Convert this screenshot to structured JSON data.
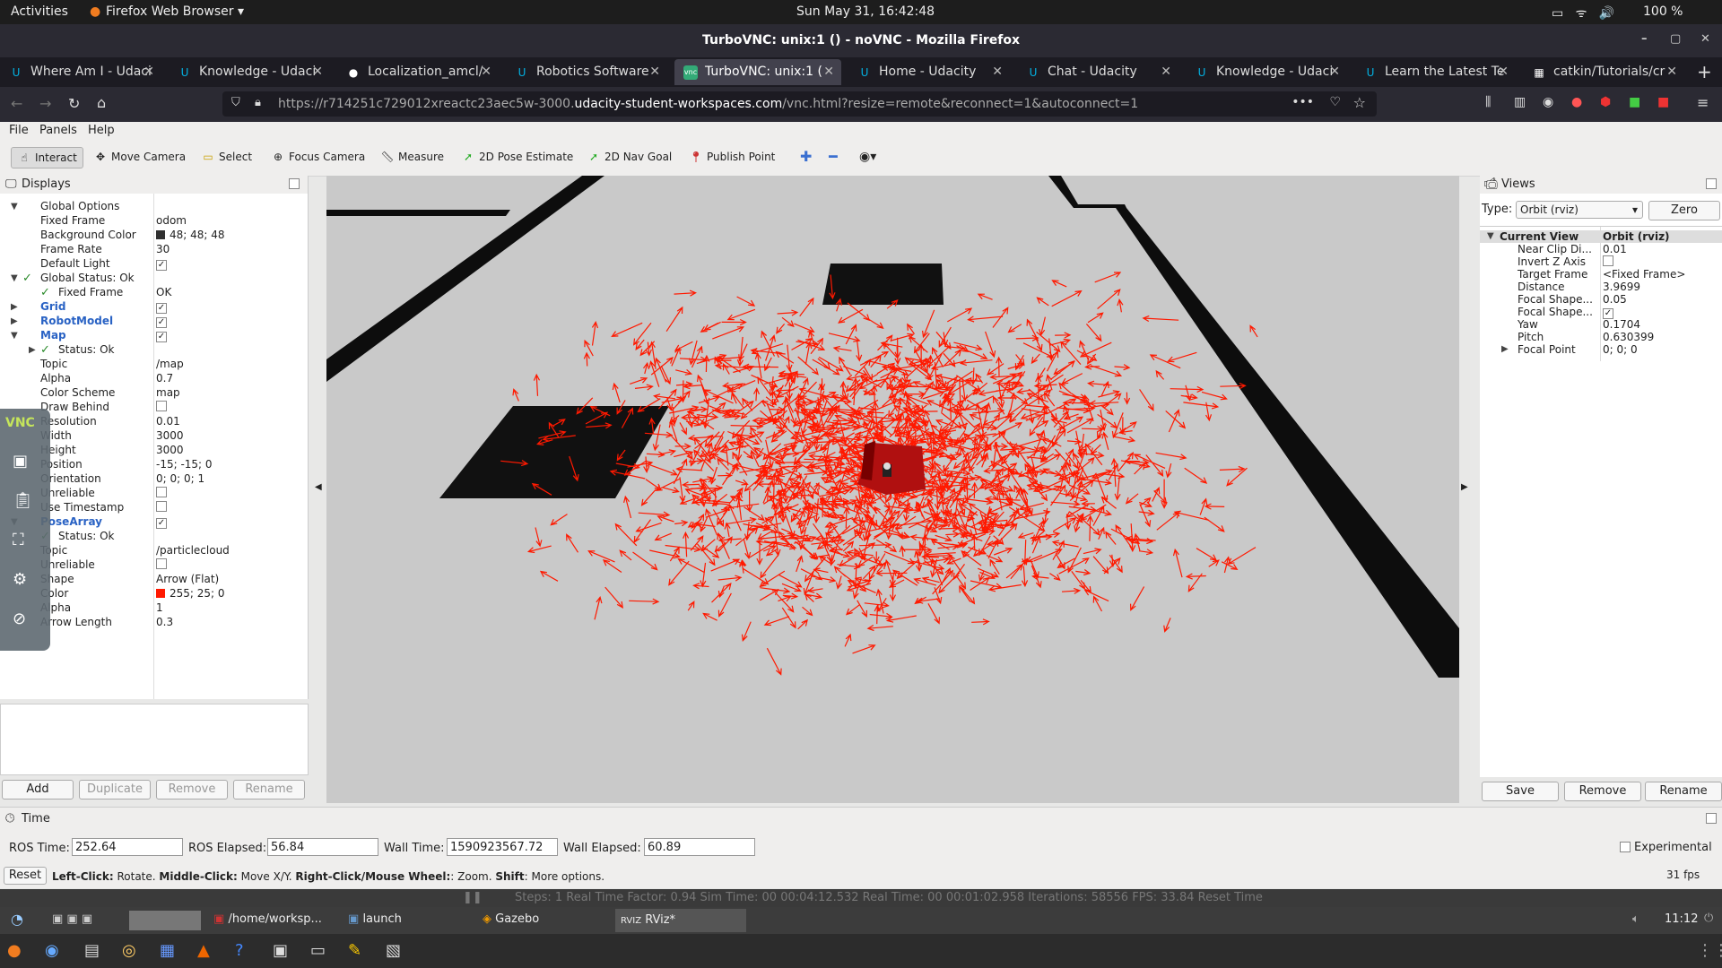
{
  "gnome": {
    "activities": "Activities",
    "app": "Firefox Web Browser ▾",
    "clock": "Sun May 31, 16:42:48",
    "battery": "100 %"
  },
  "window": {
    "title": "TurboVNC: unix:1 () - noVNC - Mozilla Firefox"
  },
  "tabs": [
    {
      "label": "Where Am I - Udaci"
    },
    {
      "label": "Knowledge - Udaci"
    },
    {
      "label": "Localization_amcl/"
    },
    {
      "label": "Robotics Software"
    },
    {
      "label": "TurboVNC: unix:1 ("
    },
    {
      "label": "Home - Udacity"
    },
    {
      "label": "Chat - Udacity"
    },
    {
      "label": "Knowledge - Udaci"
    },
    {
      "label": "Learn the Latest Te"
    },
    {
      "label": "catkin/Tutorials/cr"
    }
  ],
  "url": {
    "prefix": "https://r714251c729012xreactc23aec5w-3000.",
    "domain": "udacity-student-workspaces.com",
    "suffix": "/vnc.html?resize=remote&reconnect=1&autoconnect=1"
  },
  "menu": {
    "file": "File",
    "panels": "Panels",
    "help": "Help"
  },
  "tools": [
    "Interact",
    "Move Camera",
    "Select",
    "Focus Camera",
    "Measure",
    "2D Pose Estimate",
    "2D Nav Goal",
    "Publish Point"
  ],
  "displays": {
    "title": "Displays",
    "rows": [
      {
        "k": "Global Options",
        "v": ""
      },
      {
        "k": "Fixed Frame",
        "v": "odom"
      },
      {
        "k": "Background Color",
        "v": "48; 48; 48"
      },
      {
        "k": "Frame Rate",
        "v": "30"
      },
      {
        "k": "Default Light",
        "v": ""
      },
      {
        "k": "Global Status: Ok",
        "v": ""
      },
      {
        "k": "Fixed Frame",
        "v": "OK"
      },
      {
        "k": "Grid",
        "v": ""
      },
      {
        "k": "RobotModel",
        "v": ""
      },
      {
        "k": "Map",
        "v": ""
      },
      {
        "k": "Status: Ok",
        "v": ""
      },
      {
        "k": "Topic",
        "v": "/map"
      },
      {
        "k": "Alpha",
        "v": "0.7"
      },
      {
        "k": "Color Scheme",
        "v": "map"
      },
      {
        "k": "Draw Behind",
        "v": ""
      },
      {
        "k": "Resolution",
        "v": "0.01"
      },
      {
        "k": "Width",
        "v": "3000"
      },
      {
        "k": "Height",
        "v": "3000"
      },
      {
        "k": "Position",
        "v": "-15; -15; 0"
      },
      {
        "k": "Orientation",
        "v": "0; 0; 0; 1"
      },
      {
        "k": "Unreliable",
        "v": ""
      },
      {
        "k": "Use Timestamp",
        "v": ""
      },
      {
        "k": "PoseArray",
        "v": ""
      },
      {
        "k": "Status: Ok",
        "v": ""
      },
      {
        "k": "Topic",
        "v": "/particlecloud"
      },
      {
        "k": "Unreliable",
        "v": ""
      },
      {
        "k": "Shape",
        "v": "Arrow (Flat)"
      },
      {
        "k": "Color",
        "v": "255; 25; 0"
      },
      {
        "k": "Alpha",
        "v": "1"
      },
      {
        "k": "Arrow Length",
        "v": "0.3"
      }
    ],
    "buttons": {
      "add": "Add",
      "duplicate": "Duplicate",
      "remove": "Remove",
      "rename": "Rename"
    }
  },
  "views": {
    "title": "Views",
    "type_label": "Type:",
    "type_value": "Orbit (rviz)",
    "zero": "Zero",
    "rows": [
      {
        "k": "Current View",
        "v": "Orbit (rviz)"
      },
      {
        "k": "Near Clip Di...",
        "v": "0.01"
      },
      {
        "k": "Invert Z Axis",
        "v": ""
      },
      {
        "k": "Target Frame",
        "v": "<Fixed Frame>"
      },
      {
        "k": "Distance",
        "v": "3.9699"
      },
      {
        "k": "Focal Shape...",
        "v": "0.05"
      },
      {
        "k": "Focal Shape...",
        "v": ""
      },
      {
        "k": "Yaw",
        "v": "0.1704"
      },
      {
        "k": "Pitch",
        "v": "0.630399"
      },
      {
        "k": "Focal Point",
        "v": "0; 0; 0"
      }
    ],
    "buttons": {
      "save": "Save",
      "remove": "Remove",
      "rename": "Rename"
    }
  },
  "time": {
    "title": "Time",
    "ros_time_label": "ROS Time:",
    "ros_time": "252.64",
    "ros_elapsed_label": "ROS Elapsed:",
    "ros_elapsed": "56.84",
    "wall_time_label": "Wall Time:",
    "wall_time": "1590923567.72",
    "wall_elapsed_label": "Wall Elapsed:",
    "wall_elapsed": "60.89",
    "experimental": "Experimental",
    "reset": "Reset",
    "hint_b1": "Left-Click:",
    "hint_t1": " Rotate. ",
    "hint_b2": "Middle-Click:",
    "hint_t2": " Move X/Y. ",
    "hint_b3": "Right-Click/Mouse Wheel:",
    "hint_t3": ": Zoom. ",
    "hint_b4": "Shift",
    "hint_t4": ": More options.",
    "fps": "31 fps"
  },
  "taskbar": {
    "home": "/home/worksp...",
    "launch": "launch",
    "gazebo": "Gazebo",
    "rviz": "RViz*",
    "clock": "11:12",
    "gz_status": "Steps: 1     Real Time Factor: 0.94     Sim Time: 00 00:04:12.532     Real Time: 00 00:01:02.958     Iterations: 58556     FPS: 33.84     Reset Time"
  }
}
